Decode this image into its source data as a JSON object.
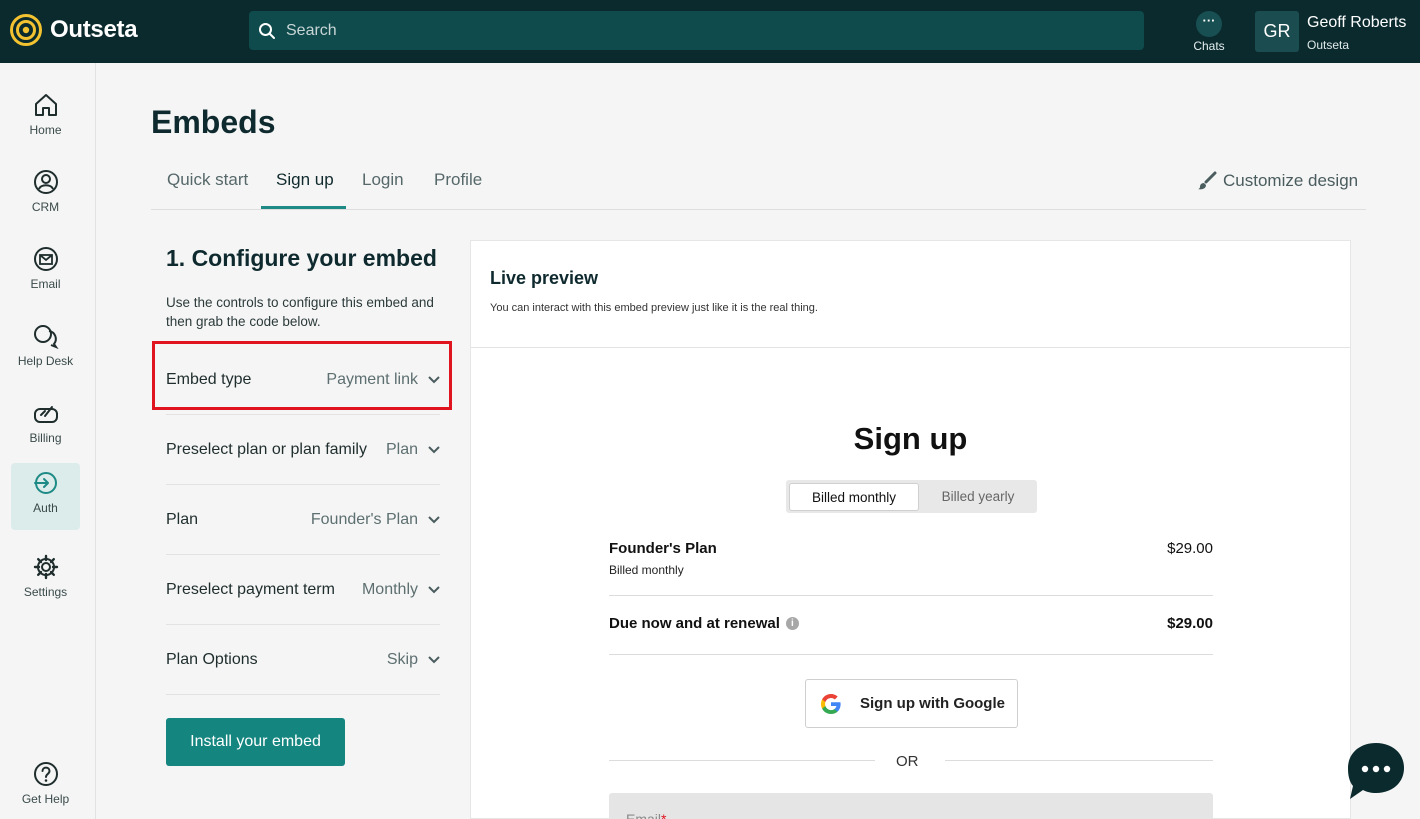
{
  "app": {
    "name": "Outseta"
  },
  "search": {
    "placeholder": "Search"
  },
  "header": {
    "chats_label": "Chats",
    "user_initials": "GR",
    "user_name": "Geoff Roberts",
    "user_org": "Outseta"
  },
  "sidebar": {
    "items": [
      {
        "label": "Home",
        "icon": "home-icon"
      },
      {
        "label": "CRM",
        "icon": "crm-icon"
      },
      {
        "label": "Email",
        "icon": "email-icon"
      },
      {
        "label": "Help Desk",
        "icon": "help-desk-icon"
      },
      {
        "label": "Billing",
        "icon": "billing-icon"
      },
      {
        "label": "Auth",
        "icon": "auth-icon",
        "active": true
      },
      {
        "label": "Settings",
        "icon": "gear-icon"
      }
    ],
    "help_label": "Get Help"
  },
  "page": {
    "title": "Embeds",
    "tabs": [
      "Quick start",
      "Sign up",
      "Login",
      "Profile"
    ],
    "active_tab": "Sign up",
    "customize_label": "Customize design"
  },
  "configure": {
    "title": "1. Configure your embed",
    "description": "Use the controls to configure this embed and then grab the code below.",
    "rows": [
      {
        "label": "Embed type",
        "value": "Payment link"
      },
      {
        "label": "Preselect plan or plan family",
        "value": "Plan"
      },
      {
        "label": "Plan",
        "value": "Founder's Plan"
      },
      {
        "label": "Preselect payment term",
        "value": "Monthly"
      },
      {
        "label": "Plan Options",
        "value": "Skip"
      }
    ],
    "install_label": "Install your embed"
  },
  "preview": {
    "title": "Live preview",
    "subtitle": "You can interact with this embed preview just like it is the real thing.",
    "signup_title": "Sign up",
    "billing_options": [
      "Billed monthly",
      "Billed yearly"
    ],
    "plan_name": "Founder's Plan",
    "plan_term": "Billed monthly",
    "plan_price": "$29.00",
    "due_label": "Due now and at renewal",
    "due_price": "$29.00",
    "google_label": "Sign up with Google",
    "or_text": "OR",
    "email_label": "Email",
    "email_required": "*"
  },
  "colors": {
    "topbar": "#0b2a2e",
    "accent": "#14857f",
    "highlight": "#e0141f"
  }
}
